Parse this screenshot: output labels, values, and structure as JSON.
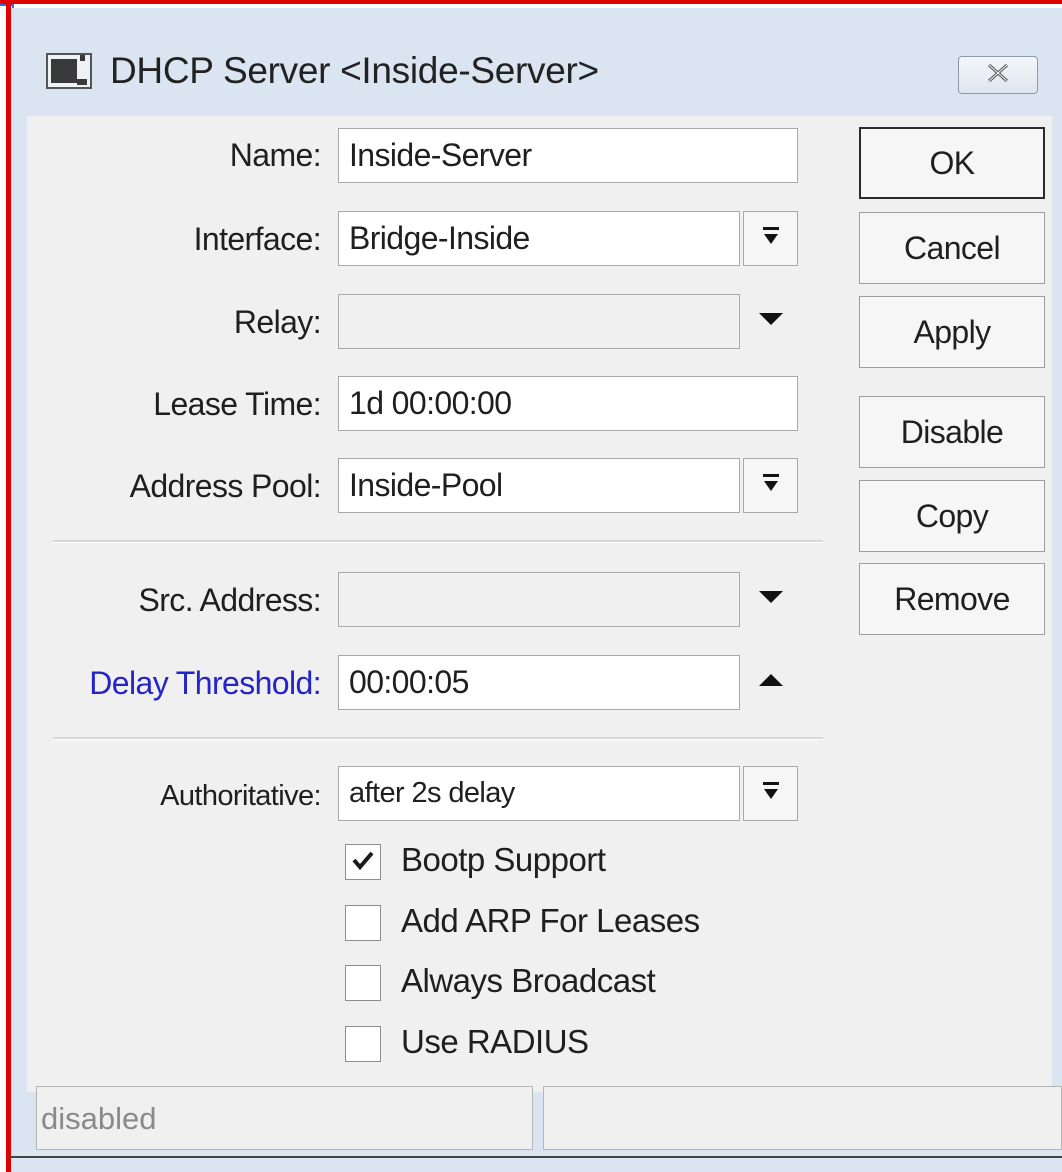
{
  "window": {
    "title": "DHCP Server <Inside-Server>",
    "close_icon": "close-icon"
  },
  "form": {
    "name": {
      "label": "Name:",
      "value": "Inside-Server"
    },
    "interface": {
      "label": "Interface:",
      "value": "Bridge-Inside"
    },
    "relay": {
      "label": "Relay:",
      "value": ""
    },
    "lease_time": {
      "label": "Lease Time:",
      "value": "1d 00:00:00"
    },
    "address_pool": {
      "label": "Address Pool:",
      "value": "Inside-Pool"
    },
    "src_address": {
      "label": "Src. Address:",
      "value": ""
    },
    "delay_threshold": {
      "label": "Delay Threshold:",
      "value": "00:00:05"
    },
    "authoritative": {
      "label": "Authoritative:",
      "value": "after 2s delay"
    }
  },
  "checkboxes": [
    {
      "label": "Bootp Support",
      "checked": true
    },
    {
      "label": "Add ARP For Leases",
      "checked": false
    },
    {
      "label": "Always Broadcast",
      "checked": false
    },
    {
      "label": "Use RADIUS",
      "checked": false
    }
  ],
  "buttons": {
    "ok": "OK",
    "cancel": "Cancel",
    "apply": "Apply",
    "disable": "Disable",
    "copy": "Copy",
    "remove": "Remove"
  },
  "status": {
    "left": "disabled",
    "right": ""
  },
  "colors": {
    "accent_label": "#2424c8",
    "frame_background": "#dbe5f1",
    "panel_background": "#f0f0f0",
    "annotation_border": "#e00000"
  }
}
